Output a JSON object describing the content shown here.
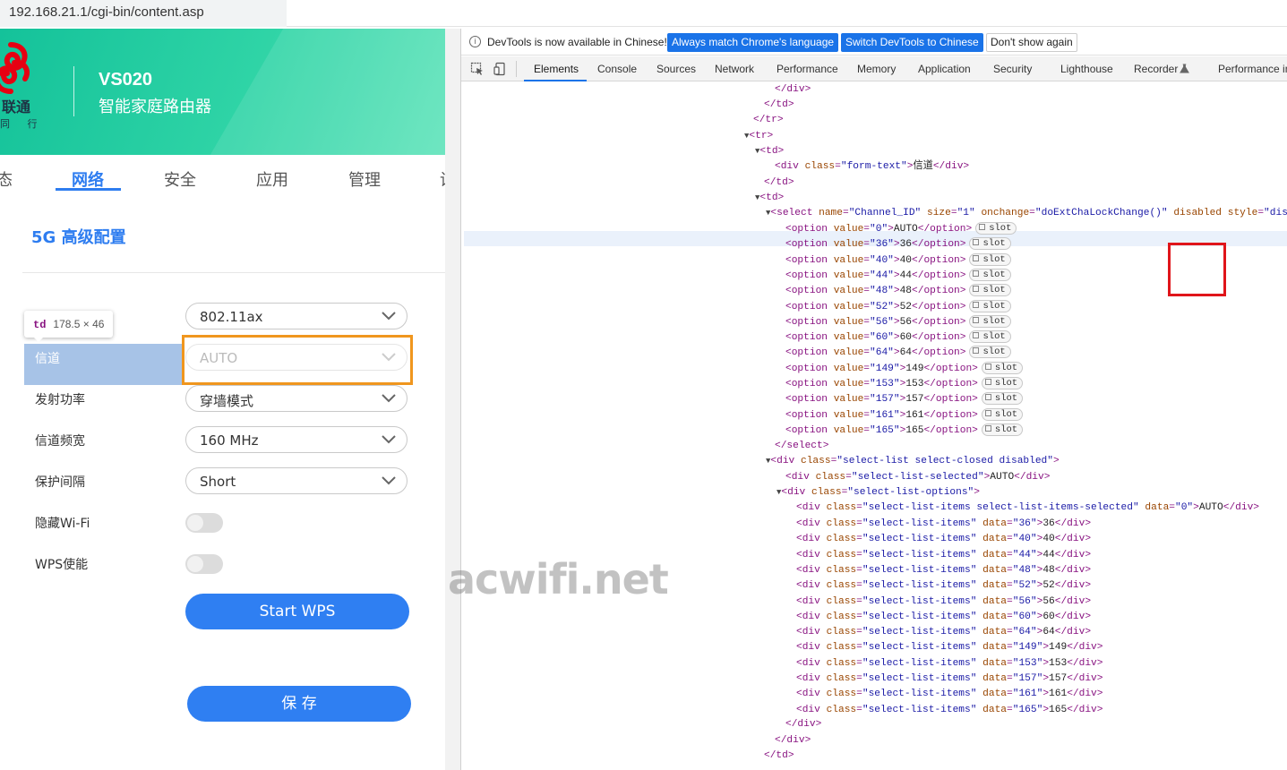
{
  "address_bar": {
    "url": "192.168.21.1/cgi-bin/content.asp"
  },
  "router": {
    "brand_text": "联通",
    "brand_sub": "同 行",
    "model": "VS020",
    "model_desc": "智能家庭路由器",
    "nav": [
      {
        "label": "态"
      },
      {
        "label": "网络"
      },
      {
        "label": "安全"
      },
      {
        "label": "应用"
      },
      {
        "label": "管理"
      },
      {
        "label": "设"
      }
    ],
    "section_title": "5G 高级配置",
    "inspector_tip": {
      "tag": "td",
      "dims": "178.5 × 46"
    },
    "fields": [
      {
        "label": "",
        "value": "802.11ax"
      },
      {
        "label": "信道",
        "value": "AUTO"
      },
      {
        "label": "发射功率",
        "value": "穿墙模式"
      },
      {
        "label": "信道频宽",
        "value": "160 MHz"
      },
      {
        "label": "保护间隔",
        "value": "Short"
      }
    ],
    "toggles": [
      {
        "label": "隐藏Wi-Fi"
      },
      {
        "label": "WPS使能"
      }
    ],
    "start_wps_label": "Start WPS",
    "save_label": "保 存",
    "watermark": "acwifi.net"
  },
  "devtools": {
    "infobar": {
      "message": "DevTools is now available in Chinese!",
      "btn_match": "Always match Chrome's language",
      "btn_switch": "Switch DevTools to Chinese",
      "btn_dismiss": "Don't show again"
    },
    "tabs": [
      "Elements",
      "Console",
      "Sources",
      "Network",
      "Performance",
      "Memory",
      "Application",
      "Security",
      "Lighthouse",
      "Recorder",
      "Performance in"
    ],
    "slot_label": "slot",
    "channels": [
      "36",
      "40",
      "44",
      "48",
      "52",
      "56",
      "60",
      "64",
      "149",
      "153",
      "157",
      "161",
      "165"
    ]
  }
}
